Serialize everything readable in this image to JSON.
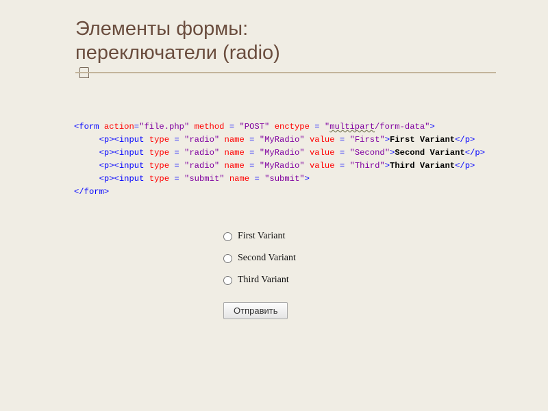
{
  "slide": {
    "title_line1": "Элементы формы:",
    "title_line2": "переключатели (radio)"
  },
  "code": {
    "open_form": "<form",
    "attr_action_name": "action",
    "attr_action_val": "\"file.php\"",
    "attr_method_name": "method",
    "attr_method_val": "\"POST\"",
    "attr_enctype_name": "enctype",
    "attr_enctype_val_plain": "\"",
    "attr_enctype_val_wavy": "multipart",
    "attr_enctype_val_rest": "/form-data\"",
    "gt": ">",
    "p_open": "<p>",
    "p_close": "</p>",
    "input_open": "<input",
    "attr_type": "type",
    "attr_name": "name",
    "attr_value": "value",
    "val_radio": "\"radio\"",
    "val_myradio": "\"MyRadio\"",
    "val_first": "\"First\"",
    "val_second": "\"Second\"",
    "val_third": "\"Third\"",
    "text_first": "First Variant",
    "text_second": "Second Variant",
    "text_third": "Third Variant",
    "val_submit_type": "\"submit\"",
    "val_submit_name": "\"submit\"",
    "close_form": "</form>"
  },
  "preview": {
    "radio1": "First Variant",
    "radio2": "Second Variant",
    "radio3": "Third Variant",
    "submit_label": "Отправить"
  }
}
